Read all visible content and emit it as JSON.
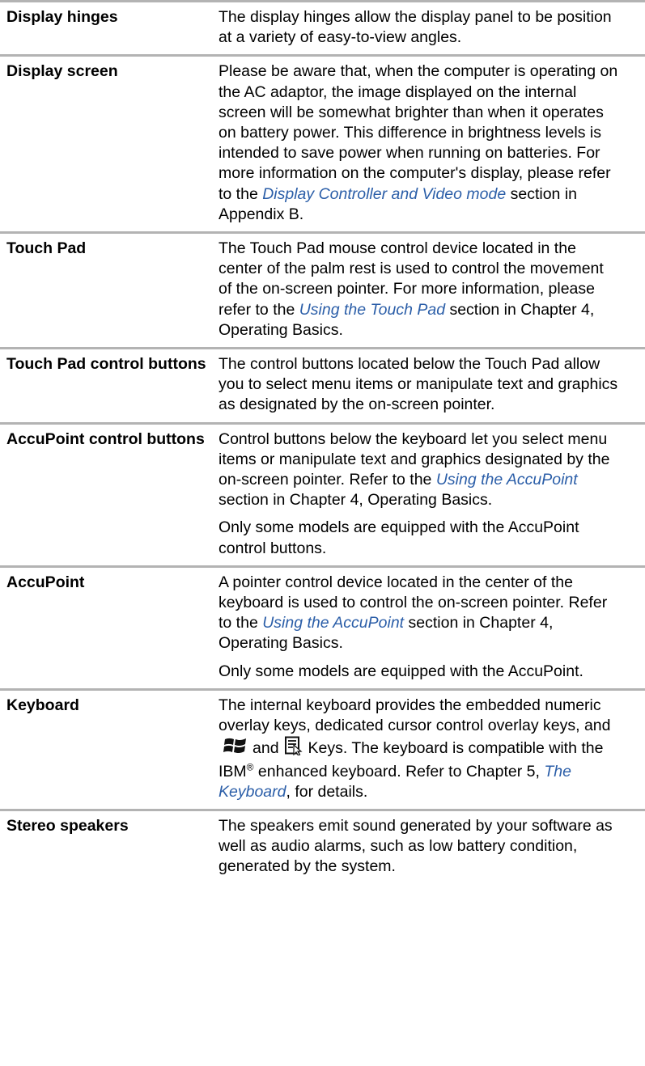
{
  "rows": [
    {
      "term": "Display hinges",
      "desc": "The display hinges allow the display panel to be position at a variety of easy-to-view angles."
    },
    {
      "term": "Display screen",
      "desc_before": "Please be aware that, when the computer is operating on the AC adaptor, the image displayed on the internal screen will be somewhat brighter than when it operates on battery power. This difference in brightness levels is intended to save power when running on batteries. For more information on the computer's display, please refer to the ",
      "link": "Display Controller and Video mode",
      "desc_after": " section in Appendix B."
    },
    {
      "term": "Touch Pad",
      "desc_before": "The Touch Pad mouse control device located in the center of the palm rest is used to control the movement of the on-screen pointer. For more information, please refer to the ",
      "link": "Using the Touch Pad",
      "desc_after": " section in Chapter 4, Operating Basics."
    },
    {
      "term": "Touch Pad control buttons",
      "desc": "The control buttons located below the Touch Pad allow you to select menu items or manipulate text and graphics as designated by the on-screen pointer."
    },
    {
      "term": "AccuPoint control buttons",
      "desc_before": "Control buttons below the keyboard let you select menu items or manipulate text and graphics designated by the on-screen pointer. Refer to the ",
      "link": "Using the AccuPoint",
      "desc_after": " section in Chapter 4, Operating Basics.",
      "note": "Only some models are equipped with the AccuPoint control buttons."
    },
    {
      "term": "AccuPoint",
      "desc_before": "A pointer control device located in the center of the keyboard is used to control the on-screen pointer. Refer to the ",
      "link": "Using the AccuPoint",
      "desc_after": " section in Chapter 4, Operating Basics.",
      "note": "Only some models are equipped with the AccuPoint."
    },
    {
      "term": "Keyboard",
      "part1": "The internal keyboard provides the embedded numeric overlay keys, dedicated cursor control overlay keys, and",
      "part2": "and",
      "part3": "Keys. The keyboard is compatible with the IBM",
      "sup": "®",
      "part4": " enhanced keyboard. Refer to Chapter 5, ",
      "link": "The Keyboard",
      "part5": ", for details."
    },
    {
      "term": "Stereo speakers",
      "desc": "The speakers emit sound generated by your software as well as audio alarms, such as low battery condition, generated by the system."
    }
  ],
  "colors": {
    "rule": "#b3b3b3",
    "link": "#2b5ea8",
    "text": "#000000"
  },
  "icons": [
    "windows-logo-icon",
    "application-menu-icon"
  ]
}
